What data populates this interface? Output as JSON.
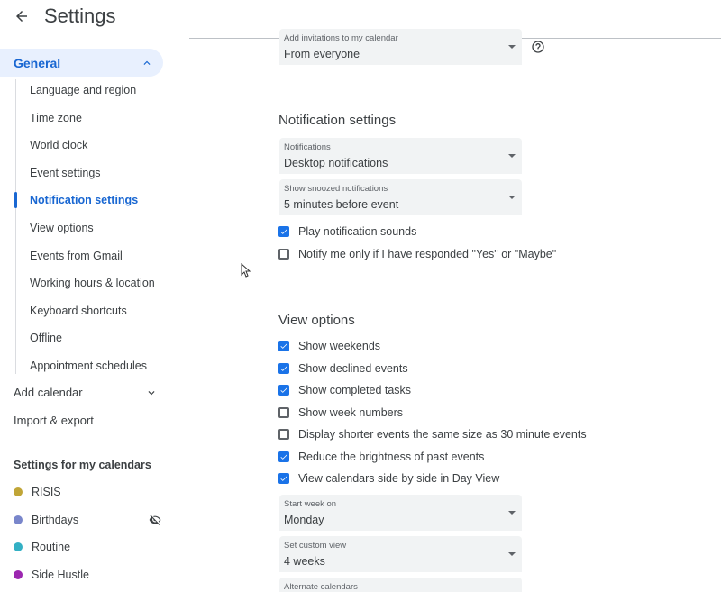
{
  "header": {
    "title": "Settings",
    "back_icon": "arrow-back-icon"
  },
  "sidebar": {
    "general_label": "General",
    "general_items": [
      "Language and region",
      "Time zone",
      "World clock",
      "Event settings",
      "Notification settings",
      "View options",
      "Events from Gmail",
      "Working hours & location",
      "Keyboard shortcuts",
      "Offline",
      "Appointment schedules"
    ],
    "active_item": "Notification settings",
    "add_calendar": "Add calendar",
    "import_export": "Import & export",
    "my_calendars_title": "Settings for my calendars",
    "calendars": [
      {
        "name": "RISIS",
        "color": "#c0a537"
      },
      {
        "name": "Birthdays",
        "color": "#7986cb",
        "hidden_icon": "visibility-off-icon"
      },
      {
        "name": "Routine",
        "color": "#33b0c4"
      },
      {
        "name": "Side Hustle",
        "color": "#9c27b0"
      }
    ]
  },
  "main": {
    "add_invitations": {
      "label": "Add invitations to my calendar",
      "value": "From everyone"
    },
    "notification_section": {
      "title": "Notification settings",
      "notifications": {
        "label": "Notifications",
        "value": "Desktop notifications"
      },
      "snoozed": {
        "label": "Show snoozed notifications",
        "value": "5 minutes before event"
      },
      "checkboxes": [
        {
          "label": "Play notification sounds",
          "checked": true
        },
        {
          "label": "Notify me only if I have responded \"Yes\" or \"Maybe\"",
          "checked": false
        }
      ]
    },
    "view_section": {
      "title": "View options",
      "checkboxes": [
        {
          "label": "Show weekends",
          "checked": true
        },
        {
          "label": "Show declined events",
          "checked": true
        },
        {
          "label": "Show completed tasks",
          "checked": true
        },
        {
          "label": "Show week numbers",
          "checked": false
        },
        {
          "label": "Display shorter events the same size as 30 minute events",
          "checked": false
        },
        {
          "label": "Reduce the brightness of past events",
          "checked": true
        },
        {
          "label": "View calendars side by side in Day View",
          "checked": true
        }
      ],
      "start_week": {
        "label": "Start week on",
        "value": "Monday"
      },
      "custom_view": {
        "label": "Set custom view",
        "value": "4 weeks"
      },
      "alternate": {
        "label": "Alternate calendars",
        "value": ""
      }
    }
  },
  "colors": {
    "accent": "#1a73e8",
    "active_text": "#1967d2",
    "active_bg": "#e8f0fe",
    "field_bg": "#f1f3f4"
  }
}
